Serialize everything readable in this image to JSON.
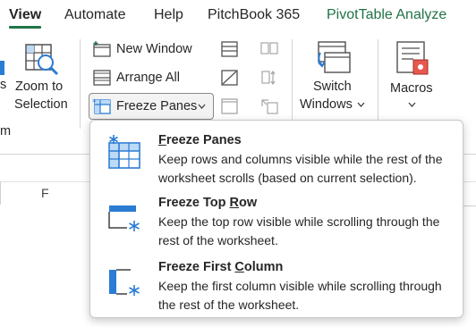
{
  "tabs": [
    {
      "label": "View",
      "active": true
    },
    {
      "label": "Automate",
      "active": false
    },
    {
      "label": "Help",
      "active": false
    },
    {
      "label": "PitchBook 365",
      "active": false
    },
    {
      "label": "PivotTable Analyze",
      "active": false
    }
  ],
  "ribbon": {
    "partial_left_label": "s",
    "partial_group_label": "m",
    "zoom_to_selection": {
      "line1": "Zoom to",
      "line2": "Selection"
    },
    "new_window": "New Window",
    "arrange_all": "Arrange All",
    "freeze_panes": "Freeze Panes",
    "switch_windows": {
      "line1": "Switch",
      "line2": "Windows"
    },
    "macros": "Macros"
  },
  "sheet": {
    "column_header": "F"
  },
  "menu": {
    "items": [
      {
        "title": "Freeze Panes",
        "access_key": "F",
        "description": "Keep rows and columns visible while the rest of the worksheet scrolls (based on current selection)."
      },
      {
        "title": "Freeze Top Row",
        "access_key": "R",
        "description": "Keep the top row visible while scrolling through the rest of the worksheet."
      },
      {
        "title": "Freeze First Column",
        "access_key": "C",
        "description": "Keep the first column visible while scrolling through the rest of the worksheet."
      }
    ]
  },
  "colors": {
    "accent_green": "#217346",
    "icon_blue": "#2b7cd3",
    "icon_light_blue": "#bcdaf5"
  }
}
